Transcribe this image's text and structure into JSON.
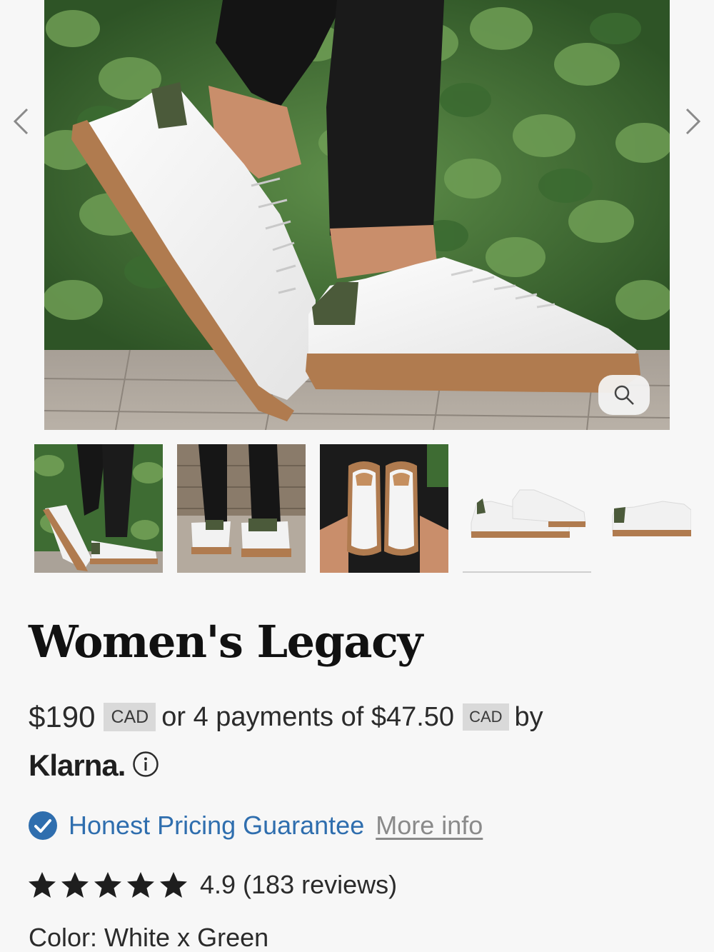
{
  "product": {
    "title": "Women's Legacy",
    "price": "$190",
    "currency": "CAD",
    "installment_prefix": "or 4 payments of",
    "installment_amount": "$47.50",
    "installment_currency": "CAD",
    "installment_suffix": "by",
    "financing_brand": "Klarna.",
    "guarantee_label": "Honest Pricing Guarantee",
    "more_info_label": "More info",
    "rating_value": 4.9,
    "rating_text": "4.9",
    "reviews_text": "(183 reviews)",
    "star_count": 5,
    "color_label": "Color:",
    "color_value": "White x Green"
  },
  "gallery": {
    "thumbnail_count": 5,
    "icons": [
      "chevron-left-icon",
      "chevron-right-icon",
      "zoom-icon"
    ]
  },
  "colors": {
    "link_blue": "#2f6eae",
    "badge_grey": "#d9d9d9",
    "sole_tan": "#b07b4f",
    "heel_green": "#4b5a3a"
  }
}
